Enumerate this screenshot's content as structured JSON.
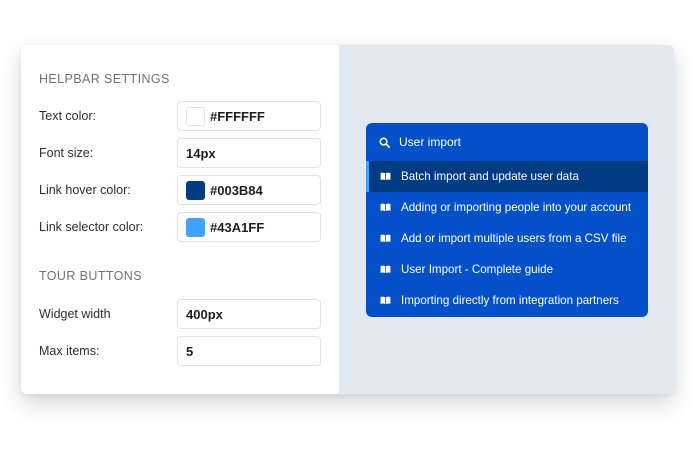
{
  "helpbar_settings": {
    "title": "HELPBAR SETTINGS",
    "rows": [
      {
        "label": "Text color:",
        "value": "#FFFFFF",
        "swatch": "#FFFFFF"
      },
      {
        "label": "Font size:",
        "value": "14px"
      },
      {
        "label": "Link hover color:",
        "value": "#003B84",
        "swatch": "#003B84"
      },
      {
        "label": "Link selector color:",
        "value": "#43A1FF",
        "swatch": "#43A1FF"
      }
    ]
  },
  "tour_buttons": {
    "title": "TOUR BUTTONS",
    "rows": [
      {
        "label": "Widget width",
        "value": "400px"
      },
      {
        "label": "Max items:",
        "value": "5"
      }
    ]
  },
  "helpbar_preview": {
    "search_text": "User import",
    "search_icon": "search-icon",
    "item_icon": "book-icon",
    "items": [
      "Batch import and update user data",
      "Adding or importing people into your account",
      "Add or import multiple users from a CSV file",
      "User Import - Complete guide",
      "Importing directly from integration partners"
    ],
    "active_index": 0
  },
  "colors": {
    "panel_bg": "#0450C8",
    "hover": "#003B84",
    "selector": "#43A1FF",
    "preview_bg": "#E3E9F3"
  }
}
